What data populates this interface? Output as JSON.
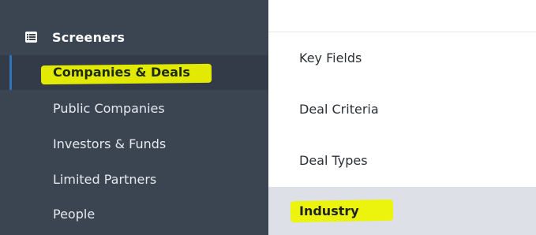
{
  "sidebar": {
    "title": "Screeners",
    "header_icon": "list-icon",
    "items": [
      {
        "label": "Companies & Deals",
        "active": true,
        "highlighted": true
      },
      {
        "label": "Public Companies",
        "active": false,
        "highlighted": false
      },
      {
        "label": "Investors & Funds",
        "active": false,
        "highlighted": false
      },
      {
        "label": "Limited Partners",
        "active": false,
        "highlighted": false
      },
      {
        "label": "People",
        "active": false,
        "highlighted": false
      }
    ]
  },
  "panel": {
    "items": [
      {
        "label": "Key Fields",
        "selected": false,
        "highlighted": false
      },
      {
        "label": "Deal Criteria",
        "selected": false,
        "highlighted": false
      },
      {
        "label": "Deal Types",
        "selected": false,
        "highlighted": false
      },
      {
        "label": "Industry",
        "selected": true,
        "highlighted": true
      }
    ]
  },
  "colors": {
    "sidebar_bg": "#3b4552",
    "sidebar_active_bg": "#323b47",
    "active_accent": "#2f73b8",
    "highlighter": "#ecf300",
    "selected_bg": "#dde1e7"
  }
}
